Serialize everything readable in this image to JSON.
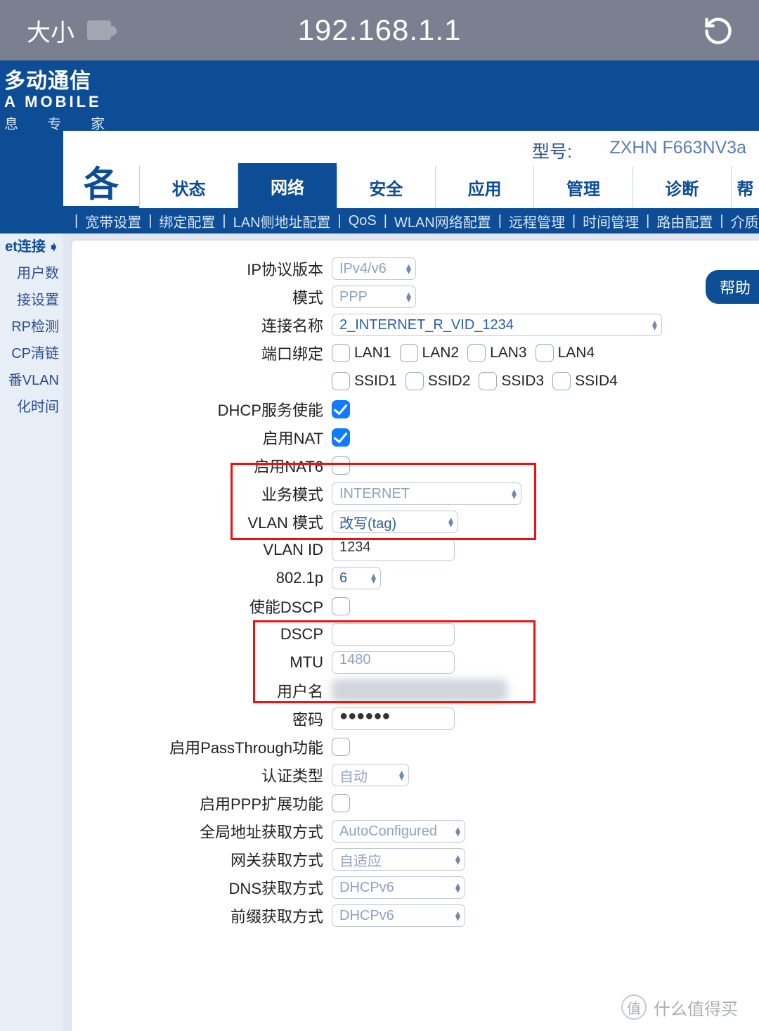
{
  "browser": {
    "size_label": "大小",
    "url": "192.168.1.1"
  },
  "brand": {
    "line1": "多动通信",
    "line2": "A MOBILE",
    "line3": "息 专 家"
  },
  "model": {
    "label": "型号:",
    "value": "ZXHN F663NV3a"
  },
  "page_glyph": "各",
  "tabs": [
    "状态",
    "网络",
    "安全",
    "应用",
    "管理",
    "诊断",
    "帮"
  ],
  "active_tab_index": 1,
  "subnav": [
    "宽带设置",
    "绑定配置",
    "LAN侧地址配置",
    "QoS",
    "WLAN网络配置",
    "远程管理",
    "时间管理",
    "路由配置",
    "介质参数"
  ],
  "help_button": "帮助",
  "sidebar": [
    {
      "label": "et连接",
      "current": true
    },
    {
      "label": "用户数"
    },
    {
      "label": "接设置"
    },
    {
      "label": "RP检测"
    },
    {
      "label": "CP清链"
    },
    {
      "label": "番VLAN"
    },
    {
      "label": "化时间"
    }
  ],
  "form": {
    "ip_version": {
      "label": "IP协议版本",
      "value": "IPv4/v6",
      "disabled": true
    },
    "mode": {
      "label": "模式",
      "value": "PPP",
      "disabled": true
    },
    "conn_name": {
      "label": "连接名称",
      "value": "2_INTERNET_R_VID_1234"
    },
    "port_bind": {
      "label": "端口绑定",
      "lan": [
        "LAN1",
        "LAN2",
        "LAN3",
        "LAN4"
      ],
      "ssid": [
        "SSID1",
        "SSID2",
        "SSID3",
        "SSID4"
      ]
    },
    "dhcp_enable": {
      "label": "DHCP服务使能",
      "checked": true
    },
    "nat": {
      "label": "启用NAT",
      "checked": true
    },
    "nat6": {
      "label": "启用NAT6",
      "checked": false
    },
    "service_mode": {
      "label": "业务模式",
      "value": "INTERNET",
      "disabled": true
    },
    "vlan_mode": {
      "label": "VLAN 模式",
      "value": "改写(tag)"
    },
    "vlan_id": {
      "label": "VLAN ID",
      "value": "1234"
    },
    "p8021": {
      "label": "802.1p",
      "value": "6"
    },
    "dscp_enable": {
      "label": "使能DSCP",
      "checked": false
    },
    "dscp": {
      "label": "DSCP",
      "value": ""
    },
    "mtu": {
      "label": "MTU",
      "value": "1480",
      "disabled": true
    },
    "username": {
      "label": "用户名",
      "value": ""
    },
    "password": {
      "label": "密码",
      "value": "●●●●●●"
    },
    "passthrough": {
      "label": "启用PassThrough功能",
      "checked": false
    },
    "auth_type": {
      "label": "认证类型",
      "value": "自动",
      "disabled": true
    },
    "ppp_ext": {
      "label": "启用PPP扩展功能",
      "checked": false
    },
    "global_addr": {
      "label": "全局地址获取方式",
      "value": "AutoConfigured",
      "disabled": true
    },
    "gateway": {
      "label": "网关获取方式",
      "value": "自适应",
      "disabled": true
    },
    "dns": {
      "label": "DNS获取方式",
      "value": "DHCPv6",
      "disabled": true
    },
    "prefix": {
      "label": "前缀获取方式",
      "value": "DHCPv6",
      "disabled": true
    }
  },
  "watermark": {
    "badge": "值",
    "text": "什么值得买"
  }
}
